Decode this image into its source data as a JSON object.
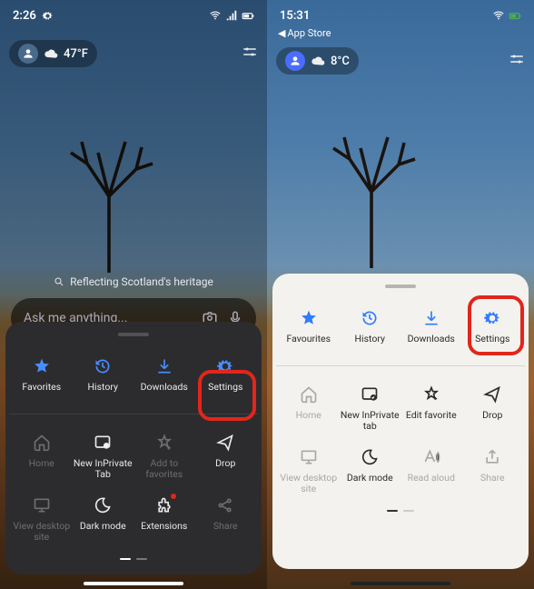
{
  "left": {
    "status": {
      "time": "2:26",
      "gear": true
    },
    "weather": {
      "temp": "47°F"
    },
    "news_label": "Reflecting Scotland's heritage",
    "search": {
      "placeholder": "Ask me anything..."
    },
    "menu_top": [
      {
        "key": "favorites",
        "label": "Favorites",
        "icon": "star"
      },
      {
        "key": "history",
        "label": "History",
        "icon": "history"
      },
      {
        "key": "downloads",
        "label": "Downloads",
        "icon": "download"
      },
      {
        "key": "settings",
        "label": "Settings",
        "icon": "gear"
      }
    ],
    "menu_grid": [
      {
        "key": "home",
        "label": "Home",
        "icon": "home",
        "enabled": false
      },
      {
        "key": "inprivate",
        "label": "New InPrivate Tab",
        "icon": "inprivate",
        "enabled": true
      },
      {
        "key": "addfav",
        "label": "Add to favorites",
        "icon": "star-plus",
        "enabled": false
      },
      {
        "key": "drop",
        "label": "Drop",
        "icon": "send",
        "enabled": true
      },
      {
        "key": "desktop",
        "label": "View desktop site",
        "icon": "desktop",
        "enabled": false
      },
      {
        "key": "darkmode",
        "label": "Dark mode",
        "icon": "moon",
        "enabled": true
      },
      {
        "key": "extensions",
        "label": "Extensions",
        "icon": "puzzle",
        "enabled": true,
        "badge": true
      },
      {
        "key": "share",
        "label": "Share",
        "icon": "share",
        "enabled": false
      }
    ]
  },
  "right": {
    "status": {
      "time": "15:31"
    },
    "app_back": "App Store",
    "weather": {
      "temp": "8°C"
    },
    "menu_top": [
      {
        "key": "favourites",
        "label": "Favourites",
        "icon": "star"
      },
      {
        "key": "history",
        "label": "History",
        "icon": "history"
      },
      {
        "key": "downloads",
        "label": "Downloads",
        "icon": "download"
      },
      {
        "key": "settings",
        "label": "Settings",
        "icon": "gear"
      }
    ],
    "menu_grid": [
      {
        "key": "home",
        "label": "Home",
        "icon": "home",
        "enabled": false
      },
      {
        "key": "inprivate",
        "label": "New InPrivate tab",
        "icon": "inprivate",
        "enabled": true
      },
      {
        "key": "editfav",
        "label": "Edit favorite",
        "icon": "star-edit",
        "enabled": true
      },
      {
        "key": "drop",
        "label": "Drop",
        "icon": "send",
        "enabled": true
      },
      {
        "key": "desktop",
        "label": "View desktop site",
        "icon": "desktop",
        "enabled": false
      },
      {
        "key": "darkmode",
        "label": "Dark mode",
        "icon": "moon",
        "enabled": true
      },
      {
        "key": "readaloud",
        "label": "Read aloud",
        "icon": "readaloud",
        "enabled": false
      },
      {
        "key": "share",
        "label": "Share",
        "icon": "share-ios",
        "enabled": false
      }
    ]
  },
  "colors": {
    "accent": "#2f7cff",
    "highlight": "#e1261c"
  }
}
